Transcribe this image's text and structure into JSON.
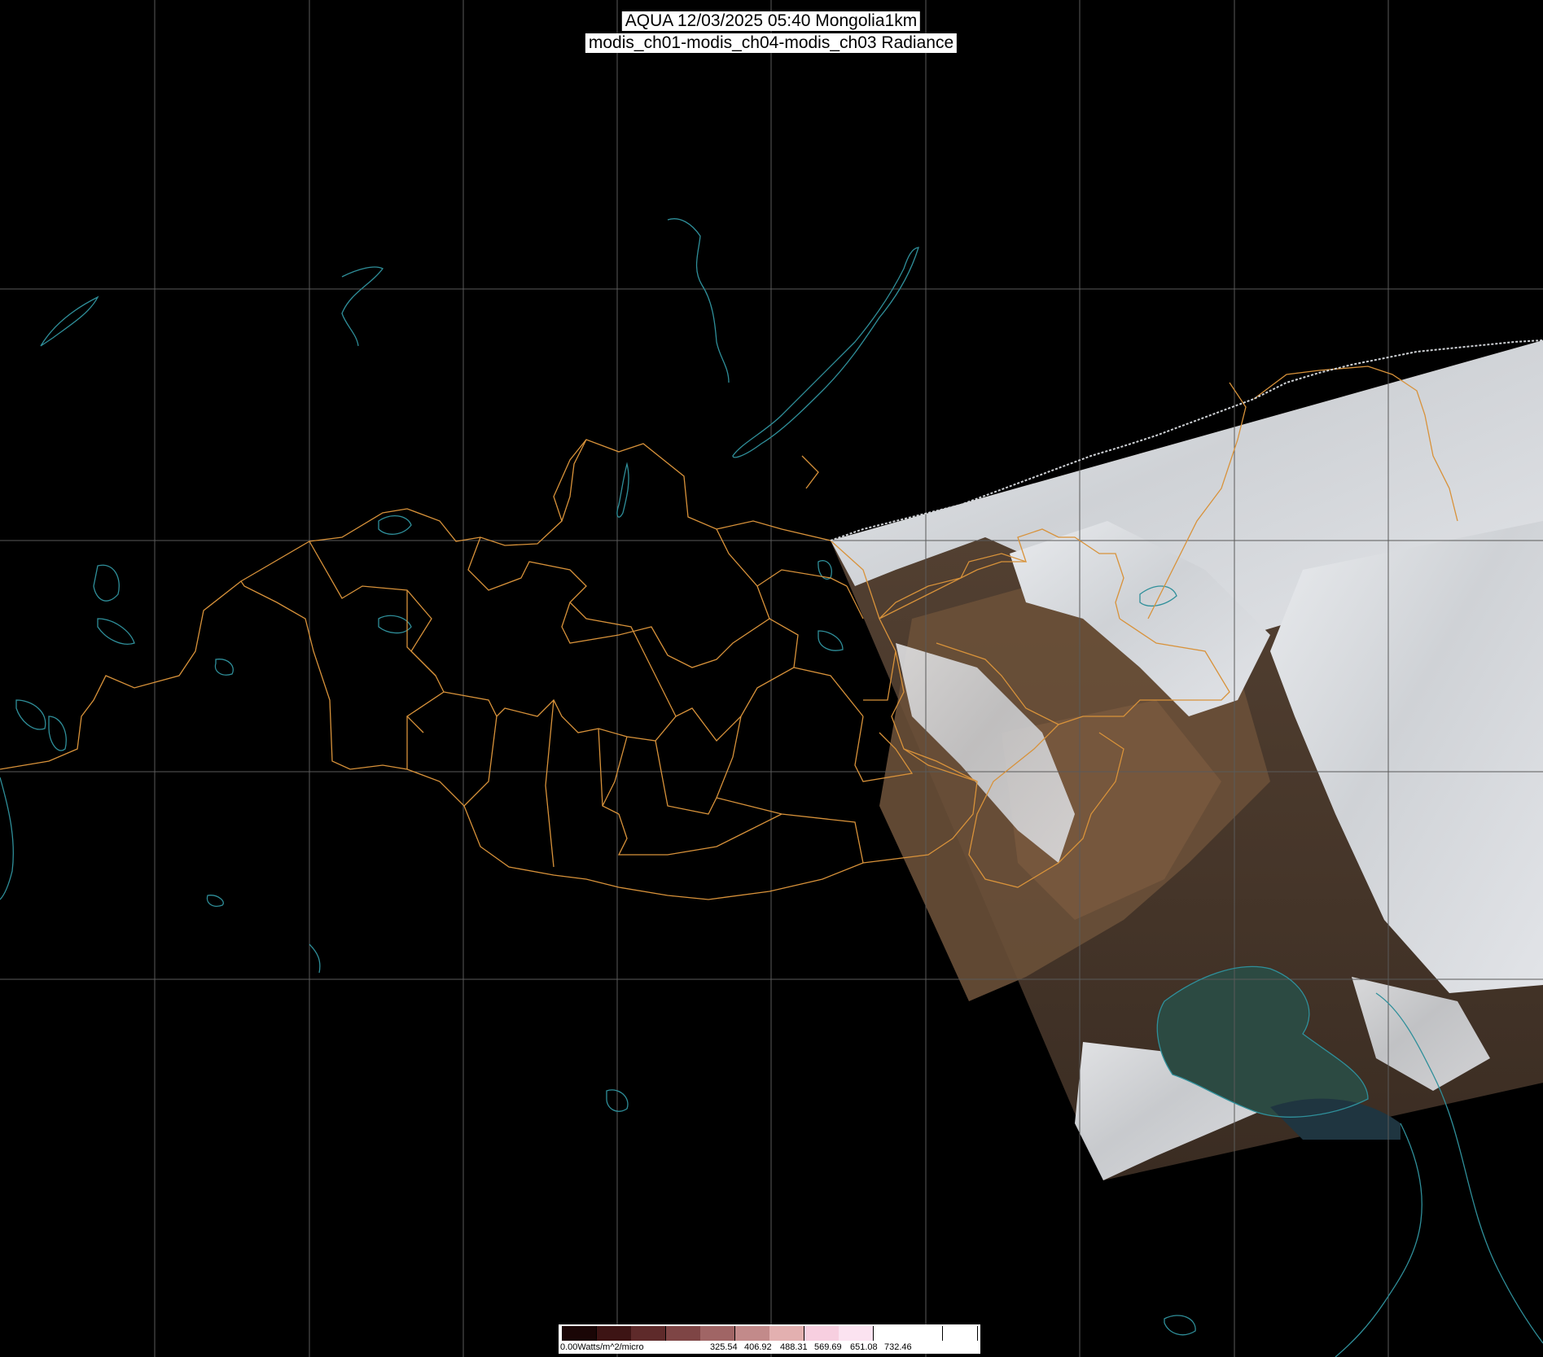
{
  "title": {
    "line1": "AQUA 12/03/2025 05:40 Mongolia1km",
    "line2": "modis_ch01-modis_ch04-modis_ch03 Radiance"
  },
  "colorbar": {
    "unit_label": "0.00Watts/m^2/micro",
    "ticks": [
      "325.54",
      "406.92",
      "488.31",
      "569.69",
      "651.08",
      "732.46"
    ],
    "colors": [
      "#1a0606",
      "#3d1414",
      "#5e2a2a",
      "#7e4545",
      "#a06565",
      "#c28a8a",
      "#e3b0b0",
      "#f7cfe0",
      "#fbe3f0",
      "#ffffff",
      "#ffffff",
      "#ffffff"
    ]
  },
  "style": {
    "background": "#000000",
    "grid_color": "#5a5a5a",
    "boundary_color": "#d8923a",
    "coast_color": "#2f8f9a"
  }
}
